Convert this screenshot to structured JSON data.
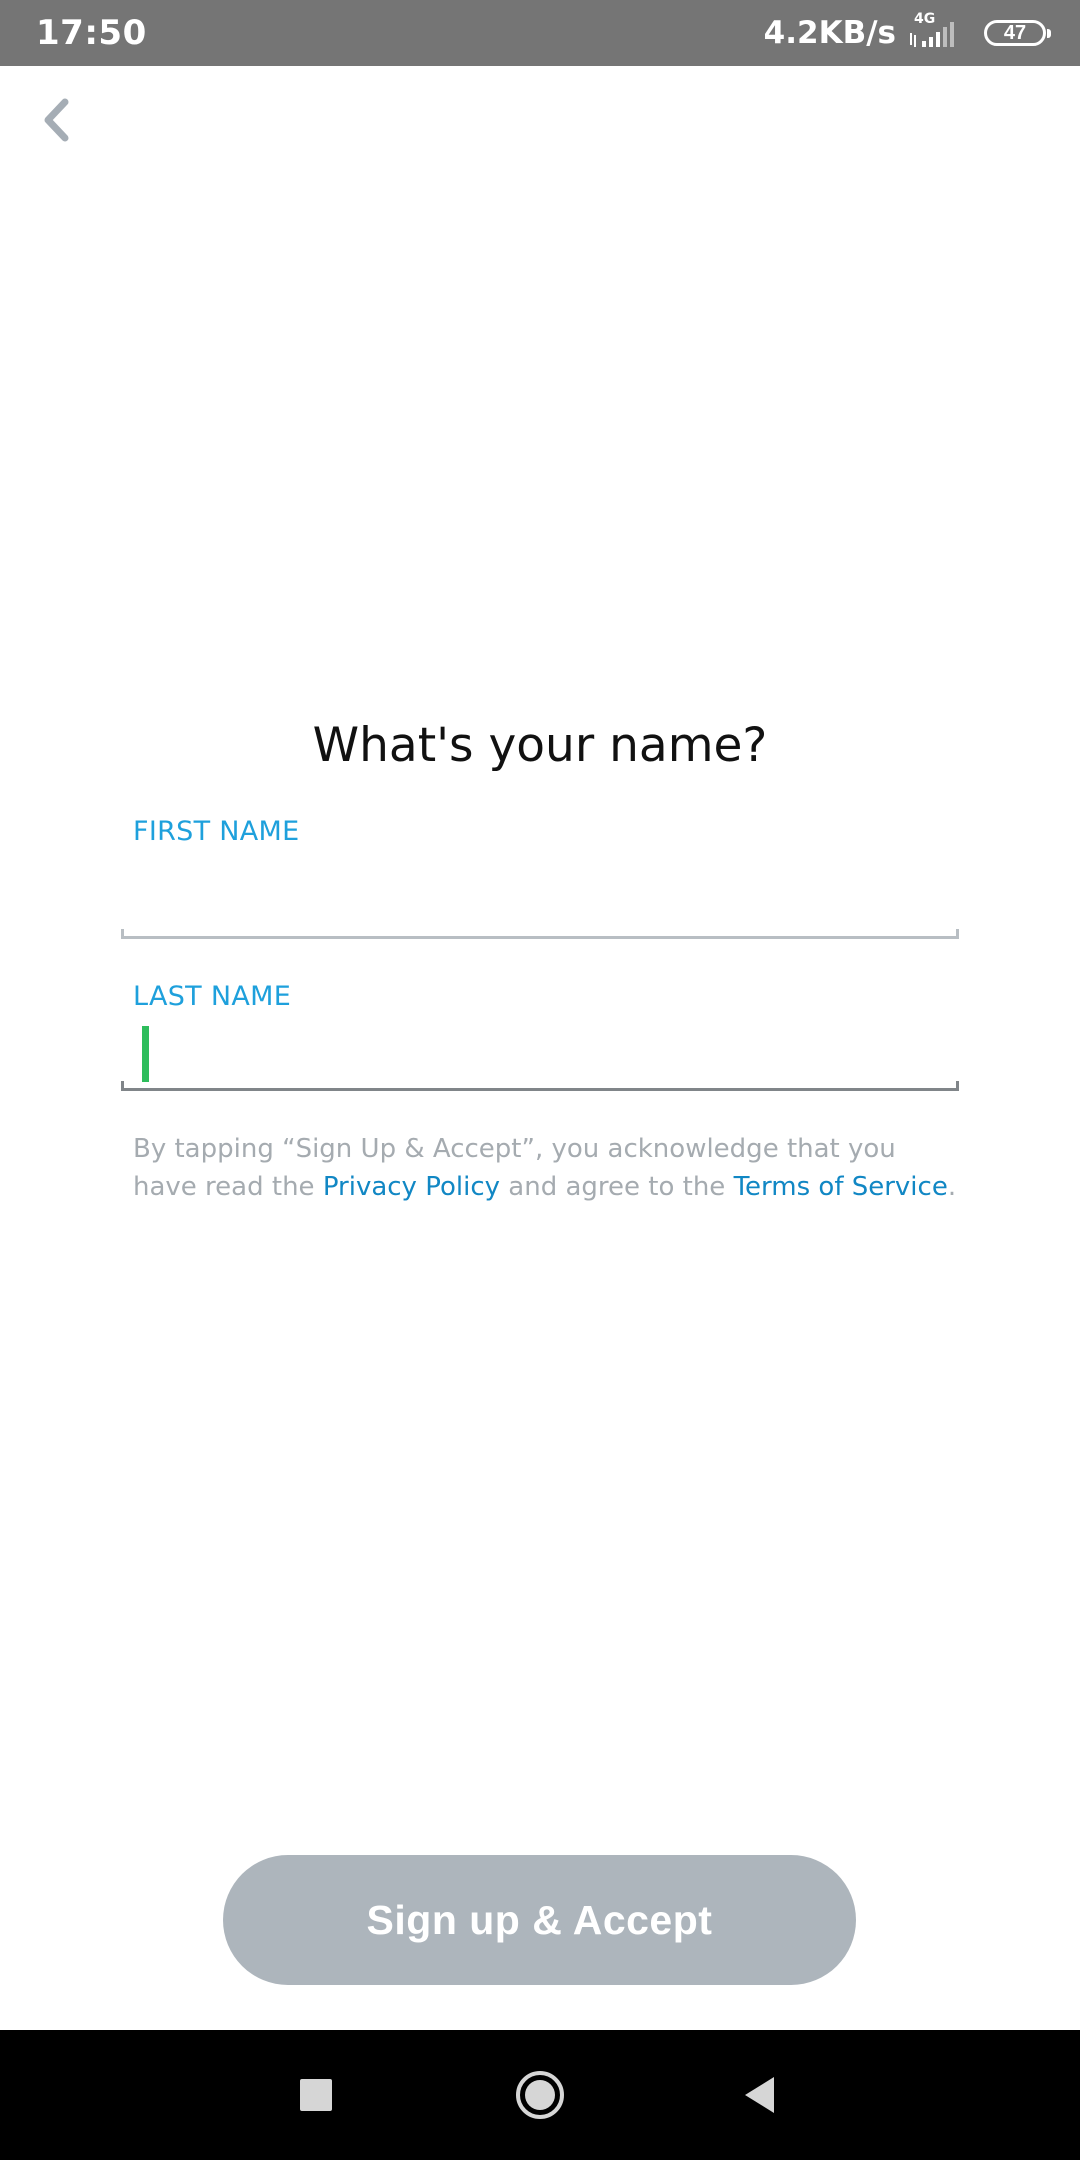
{
  "status_bar": {
    "time": "17:50",
    "net_speed": "4.2KB/s",
    "net_type": "4G",
    "battery": "47"
  },
  "header": {
    "back_icon": "chevron-left-icon"
  },
  "form": {
    "title": "What's your name?",
    "first_name": {
      "label": "FIRST NAME",
      "value": "",
      "placeholder": ""
    },
    "last_name": {
      "label": "LAST NAME",
      "value": "",
      "placeholder": ""
    }
  },
  "legal": {
    "prefix": "By tapping “Sign Up & Accept”, you acknowledge that you have read the ",
    "privacy_link": "Privacy Policy",
    "middle": " and agree to the ",
    "terms_link": "Terms of Service",
    "suffix": "."
  },
  "actions": {
    "signup_label": "Sign up & Accept"
  },
  "nav_bar": {
    "recents_icon": "square-icon",
    "home_icon": "circle-icon",
    "back_icon": "triangle-back-icon"
  },
  "colors": {
    "accent": "#1ea0dc",
    "link": "#1187c4",
    "button_disabled": "#adb5bc",
    "caret": "#2ebd5c",
    "status_bar": "#757575"
  }
}
